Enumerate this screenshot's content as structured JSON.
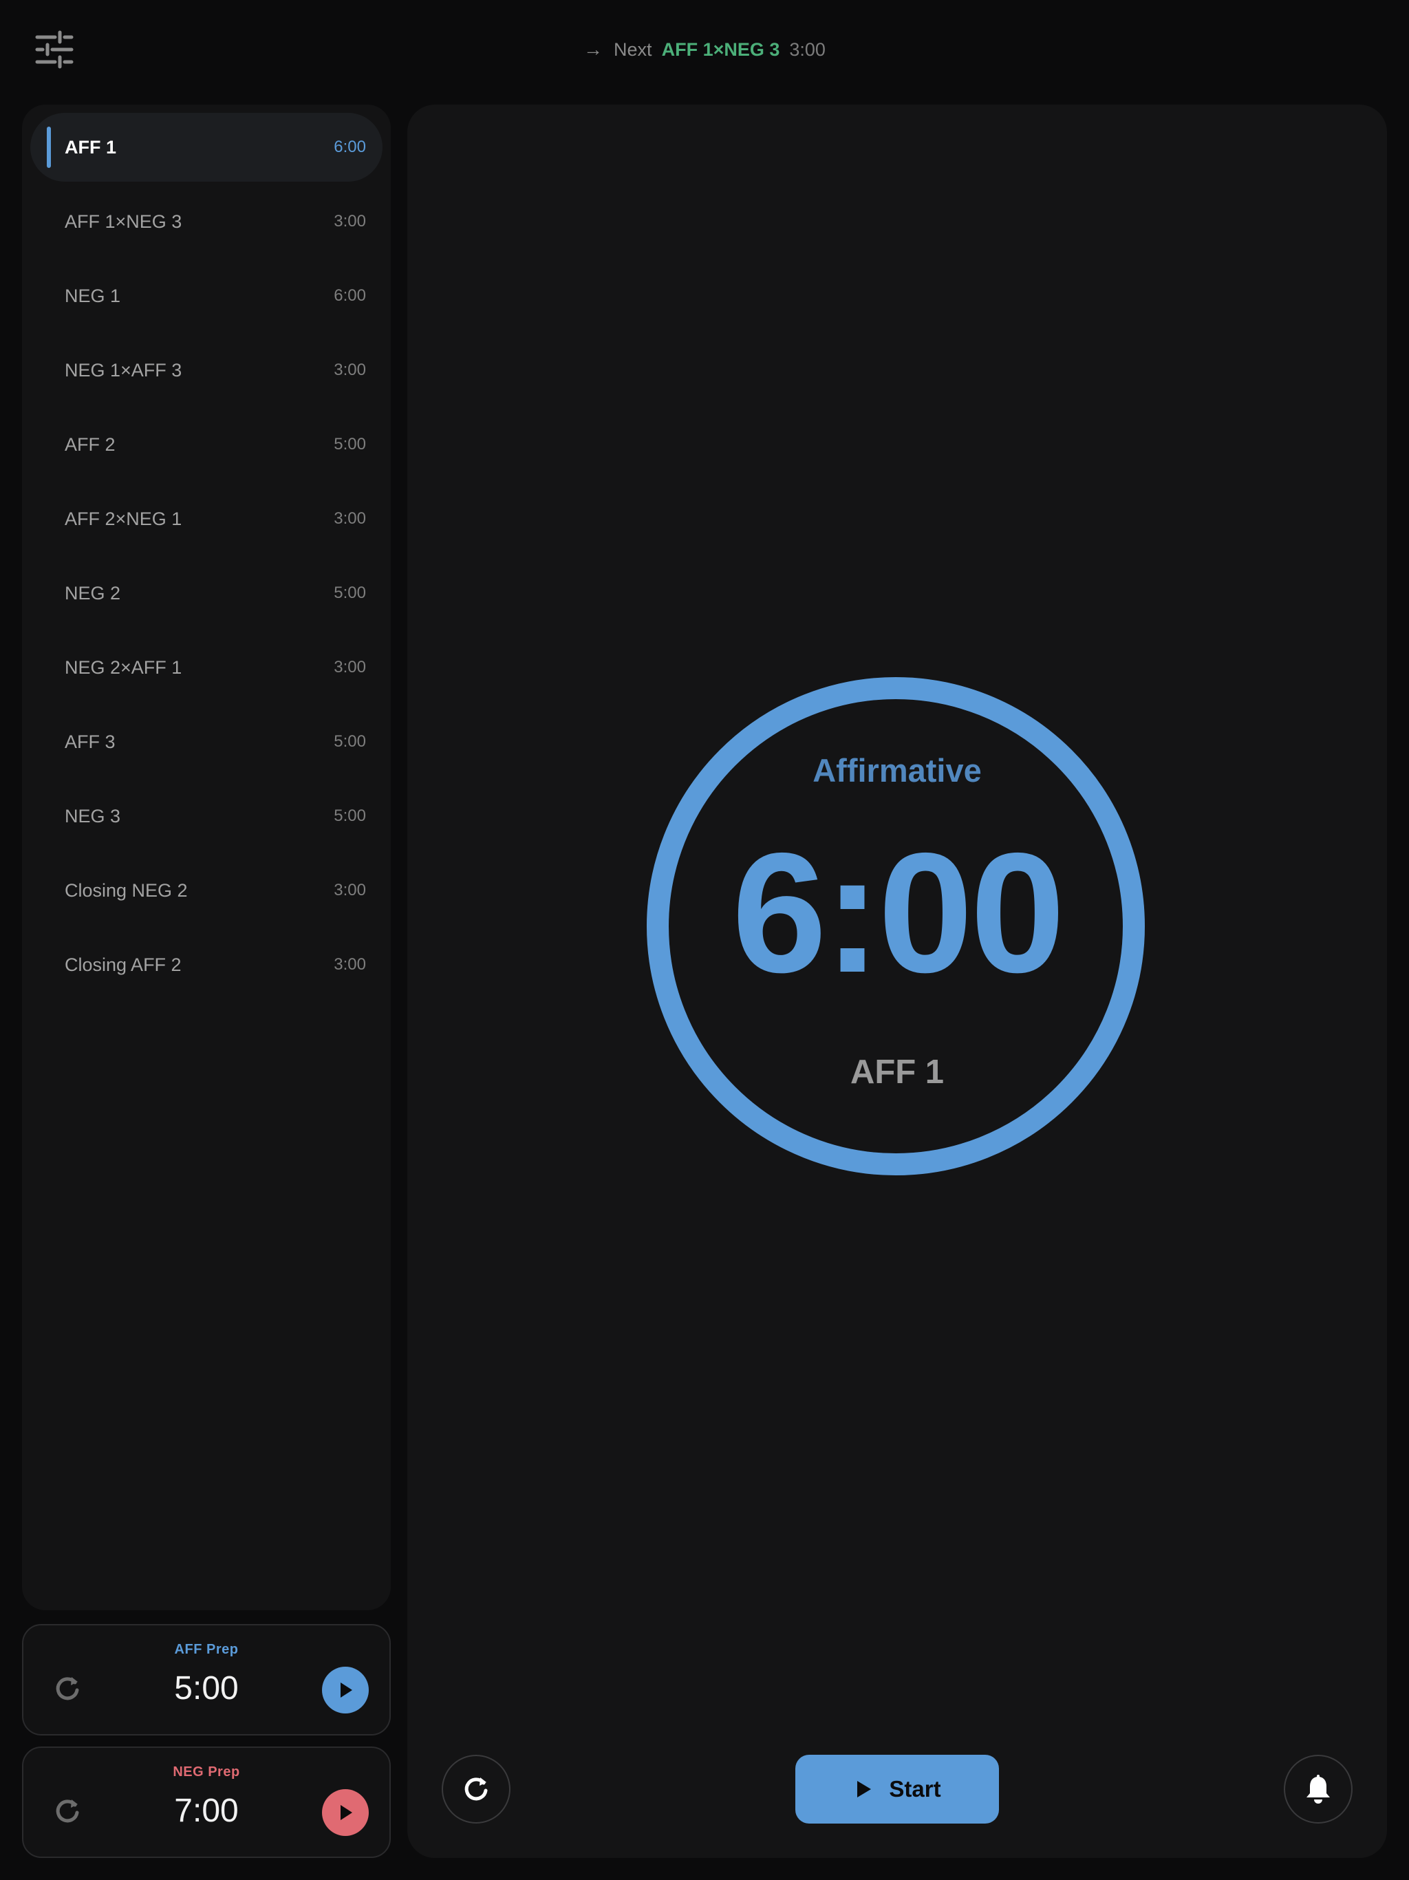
{
  "header": {
    "settings_icon": "sliders-icon",
    "next_label": "Next",
    "next_segment": "AFF 1×NEG 3",
    "next_time": "3:00"
  },
  "segments": [
    {
      "name": "AFF 1",
      "time": "6:00",
      "active": true
    },
    {
      "name": "AFF 1×NEG 3",
      "time": "3:00"
    },
    {
      "name": "NEG 1",
      "time": "6:00"
    },
    {
      "name": "NEG 1×AFF 3",
      "time": "3:00"
    },
    {
      "name": "AFF 2",
      "time": "5:00"
    },
    {
      "name": "AFF 2×NEG 1",
      "time": "3:00"
    },
    {
      "name": "NEG 2",
      "time": "5:00"
    },
    {
      "name": "NEG 2×AFF 1",
      "time": "3:00"
    },
    {
      "name": "AFF 3",
      "time": "5:00"
    },
    {
      "name": "NEG 3",
      "time": "5:00"
    },
    {
      "name": "Closing NEG 2",
      "time": "3:00"
    },
    {
      "name": "Closing AFF 2",
      "time": "3:00"
    }
  ],
  "prep": {
    "aff": {
      "title": "AFF Prep",
      "time": "5:00"
    },
    "neg": {
      "title": "NEG Prep",
      "time": "7:00"
    }
  },
  "timer": {
    "side": "Affirmative",
    "time": "6:00",
    "segment": "AFF 1",
    "progress": 1.0
  },
  "controls": {
    "start_label": "Start",
    "reset_icon": "refresh-icon",
    "bell_icon": "bell-icon"
  },
  "colors": {
    "aff": "#5b9bd9",
    "neg": "#e06a72",
    "next": "#4caf79",
    "background": "#0b0b0c"
  }
}
